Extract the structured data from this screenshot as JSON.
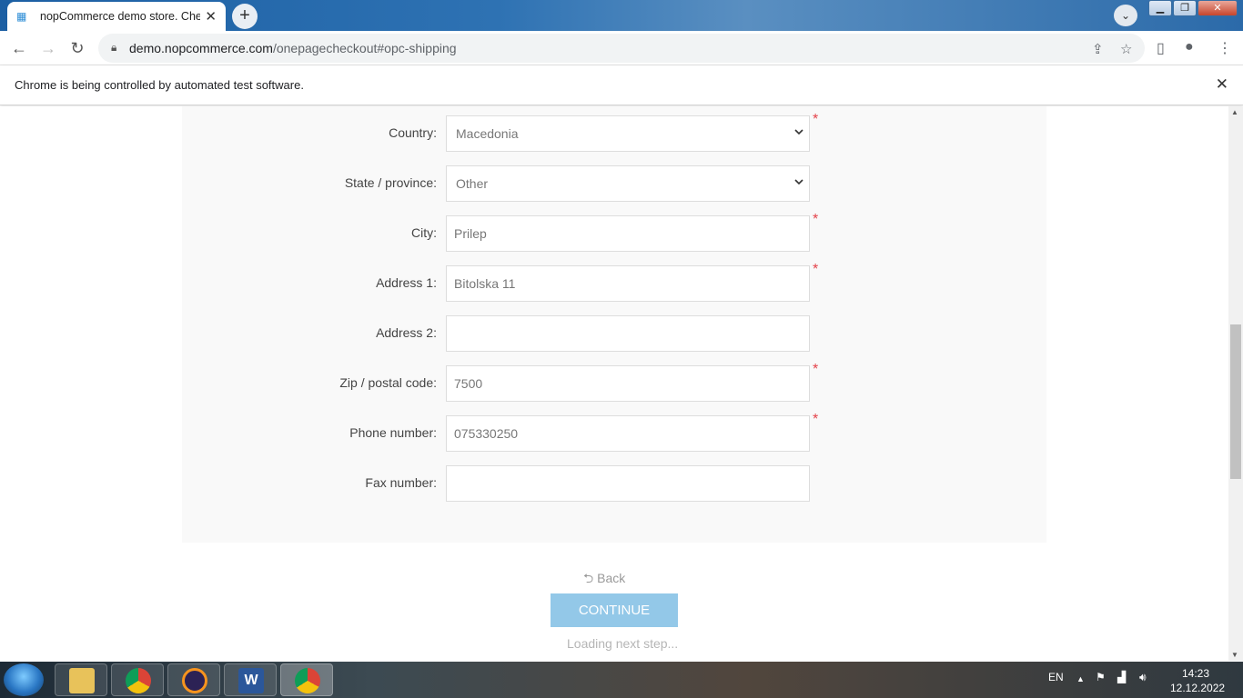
{
  "browser": {
    "tab_title": "nopCommerce demo store. Chec",
    "url_host": "demo.nopcommerce.com",
    "url_path": "/onepagecheckout#opc-shipping",
    "infobar_message": "Chrome is being controlled by automated test software."
  },
  "form": {
    "fields": [
      {
        "label": "Country:",
        "value": "Macedonia",
        "type": "select",
        "required": true
      },
      {
        "label": "State / province:",
        "value": "Other",
        "type": "select",
        "required": false
      },
      {
        "label": "City:",
        "value": "Prilep",
        "type": "text",
        "required": true
      },
      {
        "label": "Address 1:",
        "value": "Bitolska 11",
        "type": "text",
        "required": true
      },
      {
        "label": "Address 2:",
        "value": "",
        "type": "text",
        "required": false
      },
      {
        "label": "Zip / postal code:",
        "value": "7500",
        "type": "text",
        "required": true
      },
      {
        "label": "Phone number:",
        "value": "075330250",
        "type": "text",
        "required": true
      },
      {
        "label": "Fax number:",
        "value": "",
        "type": "text",
        "required": false
      }
    ],
    "required_mark": "*",
    "back_label": "Back",
    "continue_label": "CONTINUE",
    "loading_text": "Loading next step..."
  },
  "taskbar": {
    "language": "EN",
    "time": "14:23",
    "date": "12.12.2022"
  },
  "colors": {
    "continue_button": "#93c8e8",
    "required_star": "#e4434b",
    "panel_background": "#f9f9f9"
  }
}
